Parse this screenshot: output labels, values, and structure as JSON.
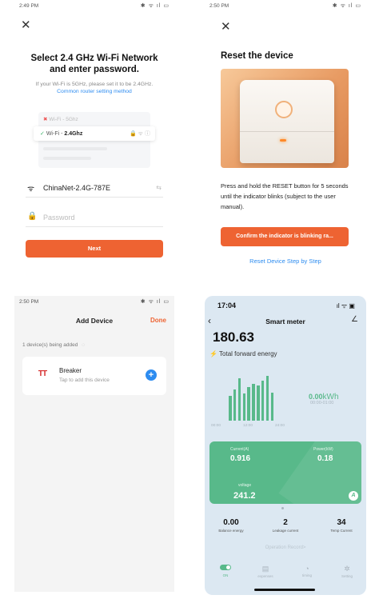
{
  "panel1": {
    "status_time": "2:49 PM",
    "status_icons": "✱ ᯤ ıl ▭",
    "title": "Select 2.4 GHz Wi-Fi Network and enter password.",
    "hint": "If your Wi-Fi is 5GHz, please set it to be 2.4GHz.",
    "link": "Common router setting method",
    "wifi_5g": "Wi-Fi - 5Ghz",
    "wifi_24_prefix": "Wi-Fi - ",
    "wifi_24_bold": "2.4Ghz",
    "network_name": "ChinaNet-2.4G-787E",
    "password_placeholder": "Password",
    "next_label": "Next"
  },
  "panel2": {
    "status_time": "2:50 PM",
    "status_icons": "✱ ᯤ ıl ▭",
    "title": "Reset the device",
    "instructions": "Press and hold the RESET button for 5 seconds until the indicator blinks (subject to the user manual).",
    "confirm_label": "Confirm the indicator is blinking ra...",
    "step_link": "Reset Device Step by Step"
  },
  "panel3": {
    "status_time": "2:50 PM",
    "status_icons": "✱ ᯤ ıl ▭",
    "title": "Add Device",
    "done_label": "Done",
    "adding_text": "1 device(s) being added",
    "device_name": "Breaker",
    "device_sub": "Tap to add this device",
    "brand_letters": "TT"
  },
  "panel4": {
    "status_time": "17:04",
    "status_icons": "ıl ᯤ ▣",
    "title": "Smart meter",
    "energy_value": "180.63",
    "energy_label": "Total forward energy",
    "kwh_value": "0.00",
    "kwh_unit": "kWh",
    "kwh_range": "00:00-01:00",
    "axis_labels": [
      "00:00",
      "12:00",
      "24:00"
    ],
    "chart_bars": [
      0.55,
      0.7,
      0.95,
      0.6,
      0.75,
      0.82,
      0.78,
      0.9,
      1.0,
      0.62
    ],
    "current_label": "Current(A)",
    "current_value": "0.916",
    "power_label": "Power(kW)",
    "power_value": "0.18",
    "voltage_label": "voltage",
    "voltage_value": "241.2",
    "badge": "A",
    "balance_value": "0.00",
    "balance_label": "Balance energy",
    "leakage_value": "2",
    "leakage_label": "Leakage current",
    "temp_value": "34",
    "temp_label": "Temp Current",
    "records_label": "Operation Record>",
    "nav": [
      "ON",
      "expenses",
      "timing",
      "Setting"
    ],
    "colors": {
      "accent_green": "#58b98a",
      "orange": "#ee6332",
      "link_blue": "#2d8cf0"
    }
  }
}
